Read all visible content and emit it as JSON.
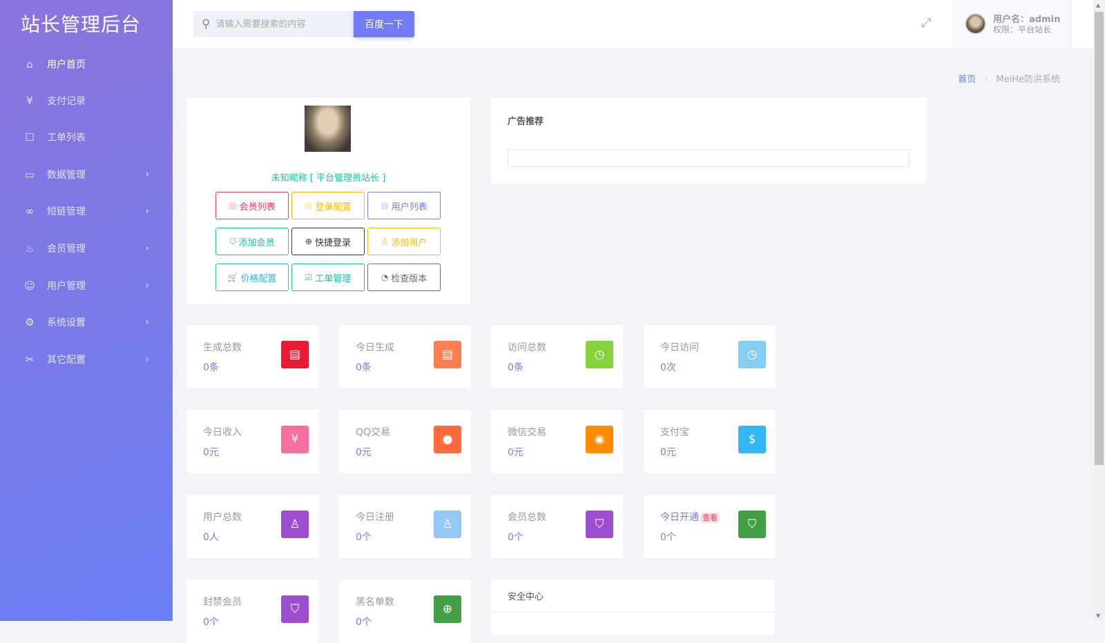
{
  "sidebar": {
    "title": "站长管理后台",
    "items": [
      {
        "label": "用户首页",
        "icon": "home-icon"
      },
      {
        "label": "支付记录",
        "icon": "yen-icon"
      },
      {
        "label": "工单列表",
        "icon": "ticket-icon"
      },
      {
        "label": "数据管理",
        "icon": "window-icon"
      },
      {
        "label": "短链管理",
        "icon": "link-icon"
      },
      {
        "label": "会员管理",
        "icon": "fire-icon"
      },
      {
        "label": "用户管理",
        "icon": "user-icon"
      },
      {
        "label": "系统设置",
        "icon": "gear-icon"
      },
      {
        "label": "其它配置",
        "icon": "tools-icon"
      }
    ]
  },
  "header": {
    "search_placeholder": "请输入需要搜索的内容",
    "search_button": "百度一下",
    "username": "用户名：admin",
    "role": "权限：平台站长"
  },
  "breadcrumb": {
    "home": "首页",
    "current": "MeiHe防洪系统"
  },
  "profile": {
    "nickname": "未知昵称 [ 平台管理员站长 ]",
    "buttons": [
      {
        "label": "会员列表",
        "color": "#f5365c"
      },
      {
        "label": "登录配置",
        "color": "#ffb800"
      },
      {
        "label": "用户列表",
        "color": "#717cf4"
      },
      {
        "label": "添加会员",
        "color": "#19c39a"
      },
      {
        "label": "快捷登录",
        "color": "#2f3545"
      },
      {
        "label": "添加用户",
        "color": "#ffb800"
      },
      {
        "label": "价格配置",
        "color": "#3ab0d8"
      },
      {
        "label": "工单管理",
        "color": "#19c39a"
      },
      {
        "label": "检查版本",
        "color": "#666a73"
      }
    ]
  },
  "ad": {
    "title": "广告推荐"
  },
  "stats": [
    {
      "label": "生成总数",
      "value": "0条",
      "color": "#ea1a32"
    },
    {
      "label": "今日生成",
      "value": "0条",
      "color": "#ff7f50"
    },
    {
      "label": "访问总数",
      "value": "0条",
      "color": "#85d23a"
    },
    {
      "label": "今日访问",
      "value": "0次",
      "color": "#86cdf5"
    },
    {
      "label": "今日收入",
      "value": "0元",
      "color": "#f56fa0"
    },
    {
      "label": "QQ交易",
      "value": "0元",
      "color": "#ff6a3d"
    },
    {
      "label": "微信交易",
      "value": "0元",
      "color": "#ff8c00"
    },
    {
      "label": "支付宝",
      "value": "0元",
      "color": "#34b5f5"
    },
    {
      "label": "用户总数",
      "value": "0人",
      "color": "#9b4fce"
    },
    {
      "label": "今日注册",
      "value": "0个",
      "color": "#95c8f7"
    },
    {
      "label": "会员总数",
      "value": "0个",
      "color": "#9b4fce"
    },
    {
      "label": "今日开通",
      "value": "0个",
      "color": "#43a047",
      "tag": "查看"
    },
    {
      "label": "封禁会员",
      "value": "0个",
      "color": "#9b4fce"
    },
    {
      "label": "黑名单数",
      "value": "0个",
      "color": "#43a047"
    }
  ],
  "security": {
    "title": "安全中心"
  }
}
